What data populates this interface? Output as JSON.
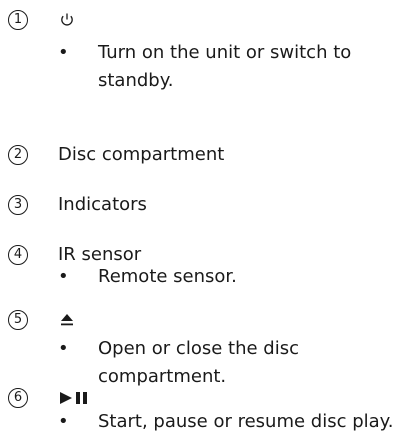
{
  "items": [
    {
      "number": "1",
      "icon": "power-icon",
      "bullet": "•",
      "description": "Turn on the unit or switch to standby."
    },
    {
      "number": "2",
      "label": "Disc compartment"
    },
    {
      "number": "3",
      "label": "Indicators"
    },
    {
      "number": "4",
      "label": "IR sensor",
      "bullet": "•",
      "description": "Remote sensor."
    },
    {
      "number": "5",
      "icon": "eject-icon",
      "bullet": "•",
      "description": "Open or close the disc compartment."
    },
    {
      "number": "6",
      "icon": "play-pause-icon",
      "bullet": "•",
      "description": "Start, pause or resume disc play."
    }
  ]
}
